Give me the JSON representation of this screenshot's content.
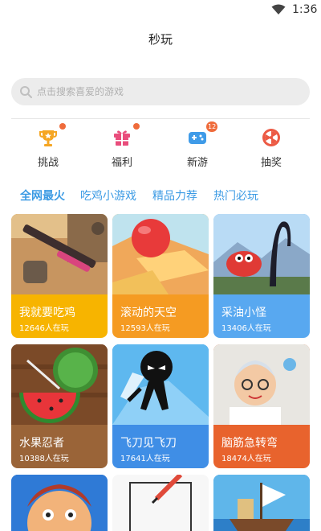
{
  "status_bar": {
    "time": "1:36",
    "wifi_icon": "wifi-icon"
  },
  "app": {
    "title": "秒玩"
  },
  "search": {
    "placeholder": "点击搜索喜爱的游戏",
    "icon": "search-icon"
  },
  "quick_actions": [
    {
      "label": "挑战",
      "icon": "trophy-icon",
      "dot": true
    },
    {
      "label": "福利",
      "icon": "gift-icon",
      "dot": true
    },
    {
      "label": "新游",
      "icon": "gamepad-icon",
      "badge": "12"
    },
    {
      "label": "抽奖",
      "icon": "lottery-wheel-icon"
    }
  ],
  "tabs": [
    {
      "label": "全网最火",
      "active": true
    },
    {
      "label": "吃鸡小游戏"
    },
    {
      "label": "精品力荐"
    },
    {
      "label": "热门必玩"
    }
  ],
  "games": [
    {
      "name": "我就要吃鸡",
      "players": "12646人在玩",
      "color": "#f7b400"
    },
    {
      "name": "滚动的天空",
      "players": "12593人在玩",
      "color": "#f59b22"
    },
    {
      "name": "采油小怪",
      "players": "13406人在玩",
      "color": "#58a8f0"
    },
    {
      "name": "水果忍者",
      "players": "10388人在玩",
      "color": "#9a6438"
    },
    {
      "name": "飞刀见飞刀",
      "players": "17641人在玩",
      "color": "#3f8ee6"
    },
    {
      "name": "脑筋急转弯",
      "players": "18474人在玩",
      "color": "#e8632d"
    }
  ],
  "colors": {
    "accent": "#3c9be4",
    "notification": "#ef6b3b",
    "search_bg": "#ececec"
  }
}
